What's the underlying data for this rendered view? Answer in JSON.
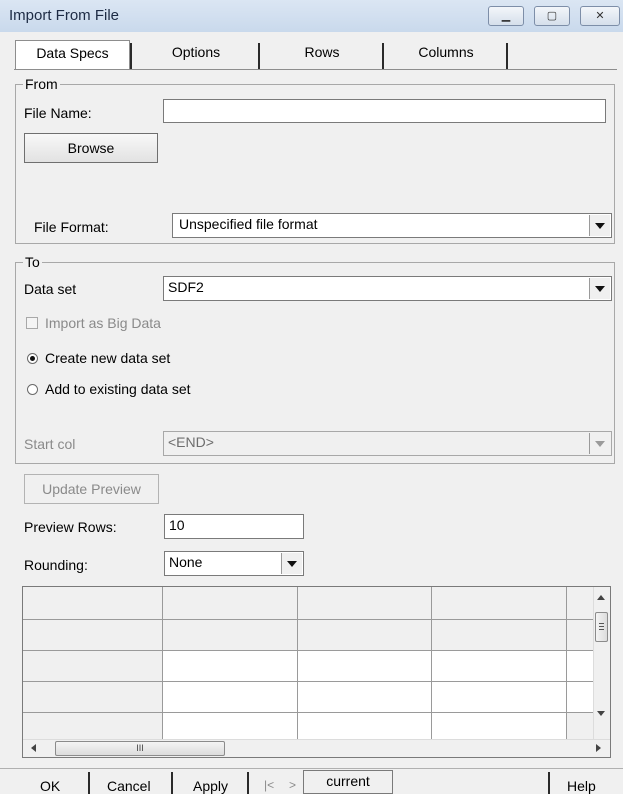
{
  "window": {
    "title": "Import From File"
  },
  "tabs": [
    "Data Specs",
    "Options",
    "Rows",
    "Columns"
  ],
  "from": {
    "legend": "From",
    "file_name_label": "File Name:",
    "file_name_value": "",
    "browse_label": "Browse",
    "file_format_label": "File Format:",
    "file_format_value": "Unspecified file format"
  },
  "to": {
    "legend": "To",
    "data_set_label": "Data set",
    "data_set_value": "SDF2",
    "big_data_label": "Import as Big Data",
    "big_data_checked": false,
    "radio_create_label": "Create new data set",
    "radio_add_label": "Add to existing data set",
    "selected_radio": "create",
    "start_col_label": "Start col",
    "start_col_value": "<END>"
  },
  "preview": {
    "update_label": "Update Preview",
    "rows_label": "Preview Rows:",
    "rows_value": "10",
    "rounding_label": "Rounding:",
    "rounding_value": "None"
  },
  "scroll": {
    "h_thumb_grip": "III"
  },
  "footer": {
    "ok": "OK",
    "cancel": "Cancel",
    "apply": "Apply",
    "nav_prev": "|<",
    "nav_next": ">",
    "current": "current",
    "help": "Help"
  }
}
